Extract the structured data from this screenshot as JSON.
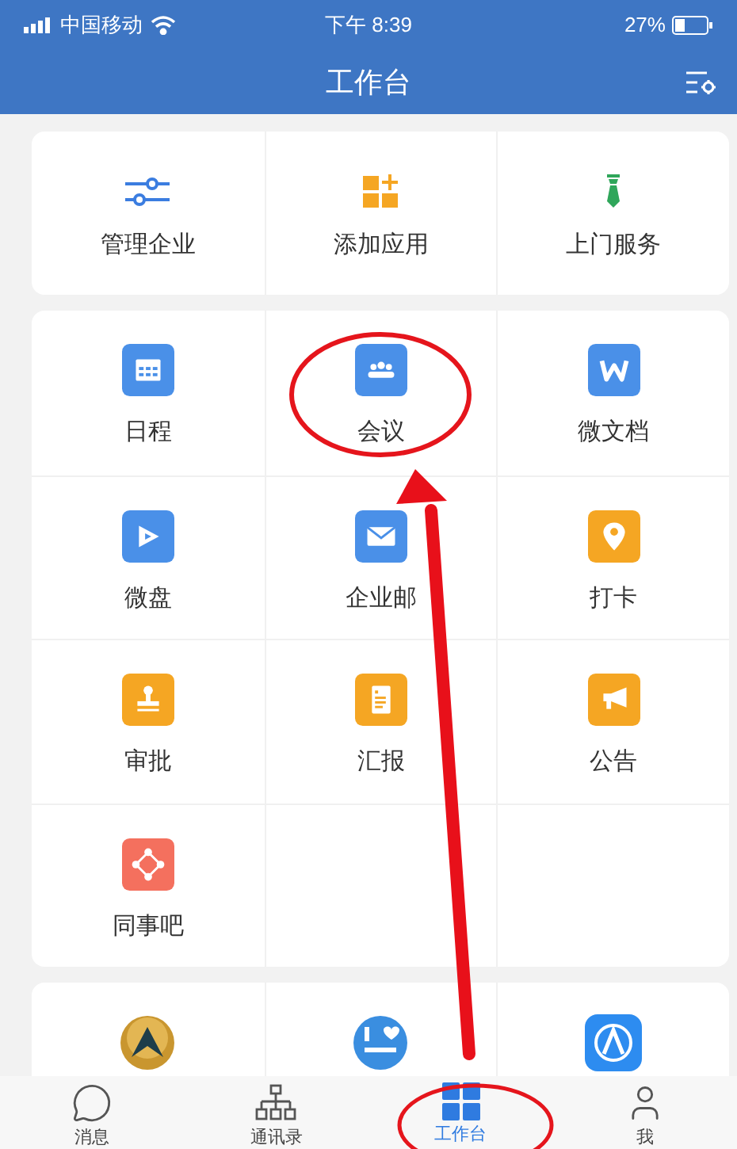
{
  "status_bar": {
    "carrier": "中国移动",
    "time": "下午 8:39",
    "battery": "27%"
  },
  "header": {
    "title": "工作台"
  },
  "actions": [
    {
      "label": "管理企业"
    },
    {
      "label": "添加应用"
    },
    {
      "label": "上门服务"
    }
  ],
  "apps": [
    {
      "label": "日程",
      "color": "#4a90e8"
    },
    {
      "label": "会议",
      "color": "#4a90e8"
    },
    {
      "label": "微文档",
      "color": "#4a90e8"
    },
    {
      "label": "微盘",
      "color": "#4a90e8"
    },
    {
      "label": "企业邮",
      "color": "#4a90e8"
    },
    {
      "label": "打卡",
      "color": "#f5a623"
    },
    {
      "label": "审批",
      "color": "#f5a623"
    },
    {
      "label": "汇报",
      "color": "#f5a623"
    },
    {
      "label": "公告",
      "color": "#f5a623"
    },
    {
      "label": "同事吧",
      "color": "#f4705e"
    }
  ],
  "tabs": [
    {
      "label": "消息",
      "selected": false
    },
    {
      "label": "通讯录",
      "selected": false
    },
    {
      "label": "工作台",
      "selected": true
    },
    {
      "label": "我",
      "selected": false
    }
  ]
}
